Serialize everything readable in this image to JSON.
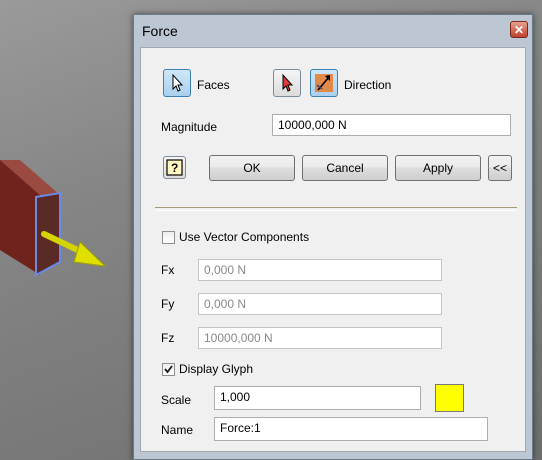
{
  "dialog": {
    "title": "Force",
    "close_glyph": "✕"
  },
  "selection": {
    "faces_label": "Faces",
    "direction_label": "Direction"
  },
  "magnitude": {
    "label": "Magnitude",
    "value": "10000,000 N"
  },
  "buttons": {
    "help_glyph": "?",
    "ok": "OK",
    "cancel": "Cancel",
    "apply": "Apply",
    "collapse": "<<"
  },
  "vector": {
    "use_label": "Use Vector Components",
    "use_checked": false,
    "fx_label": "Fx",
    "fx_value": "0,000 N",
    "fy_label": "Fy",
    "fy_value": "0,000 N",
    "fz_label": "Fz",
    "fz_value": "10000,000 N"
  },
  "glyph": {
    "display_label": "Display Glyph",
    "display_checked": true,
    "scale_label": "Scale",
    "scale_value": "1,000",
    "color": "#ffff00"
  },
  "name": {
    "label": "Name",
    "value": "Force:1"
  },
  "icons": {
    "faces": "cursor-select-icon",
    "direction_flip": "red-cursor-icon",
    "direction_pick": "direction-arrow-icon",
    "help": "help-icon",
    "force_arrow": "force-arrow-icon"
  },
  "colors": {
    "model_body": "#7a2a22",
    "model_face": "#3a5aa8",
    "arrow": "#d4d400"
  }
}
